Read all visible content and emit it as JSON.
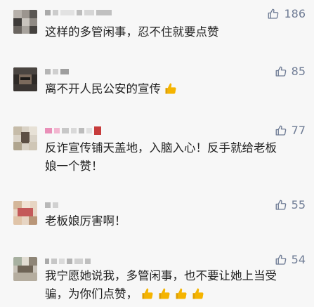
{
  "comments": [
    {
      "likes": "186",
      "text": "这样的多管闲事，忍不住就要点赞",
      "thumb_emojis": 0
    },
    {
      "likes": "85",
      "text": "离不开人民公安的宣传",
      "thumb_emojis": 1
    },
    {
      "likes": "77",
      "text": "反诈宣传铺天盖地，入脑入心！反手就给老板\n娘一个赞！",
      "thumb_emojis": 0
    },
    {
      "likes": "55",
      "text": "老板娘厉害啊！",
      "thumb_emojis": 0
    },
    {
      "likes": "54",
      "text": "我宁愿她说我，多管闲事，也不要让她上当受\n骗，为你们点赞，",
      "thumb_emojis": 4
    }
  ],
  "colors": {
    "background": "#f7f7f7",
    "like_count": "#6f7c95",
    "text": "#222222",
    "thumb_emoji": "#f5b400"
  },
  "icons": {
    "like": "thumb-up-outline-icon",
    "emoji": "thumbs-up-emoji-icon"
  }
}
